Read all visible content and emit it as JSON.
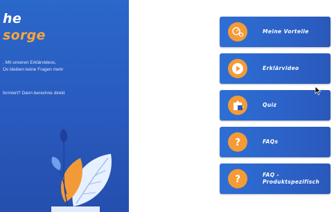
{
  "hero": {
    "title_line1": "he",
    "title_line2": "sorge",
    "text_line1": ". Mit unseren Erklärvideos,",
    "text_line2": "Os bleiben keine Fragen mehr",
    "text_line3": "formiert? Dann berechne direkt"
  },
  "menu": {
    "items": [
      {
        "label": "Meine Vorteile",
        "icon": "percent-icon"
      },
      {
        "label": "Erklärvideo",
        "icon": "play-icon"
      },
      {
        "label": "Quiz",
        "icon": "puzzle-icon"
      },
      {
        "label": "FAQs",
        "icon": "question-icon"
      },
      {
        "label_line1": "FAQ -",
        "label_line2": "Produktspezifisch",
        "icon": "question-icon"
      }
    ]
  },
  "colors": {
    "hero_blue": "#2a5cc0",
    "button_blue": "#2e6fd4",
    "accent_orange": "#f49b36"
  }
}
